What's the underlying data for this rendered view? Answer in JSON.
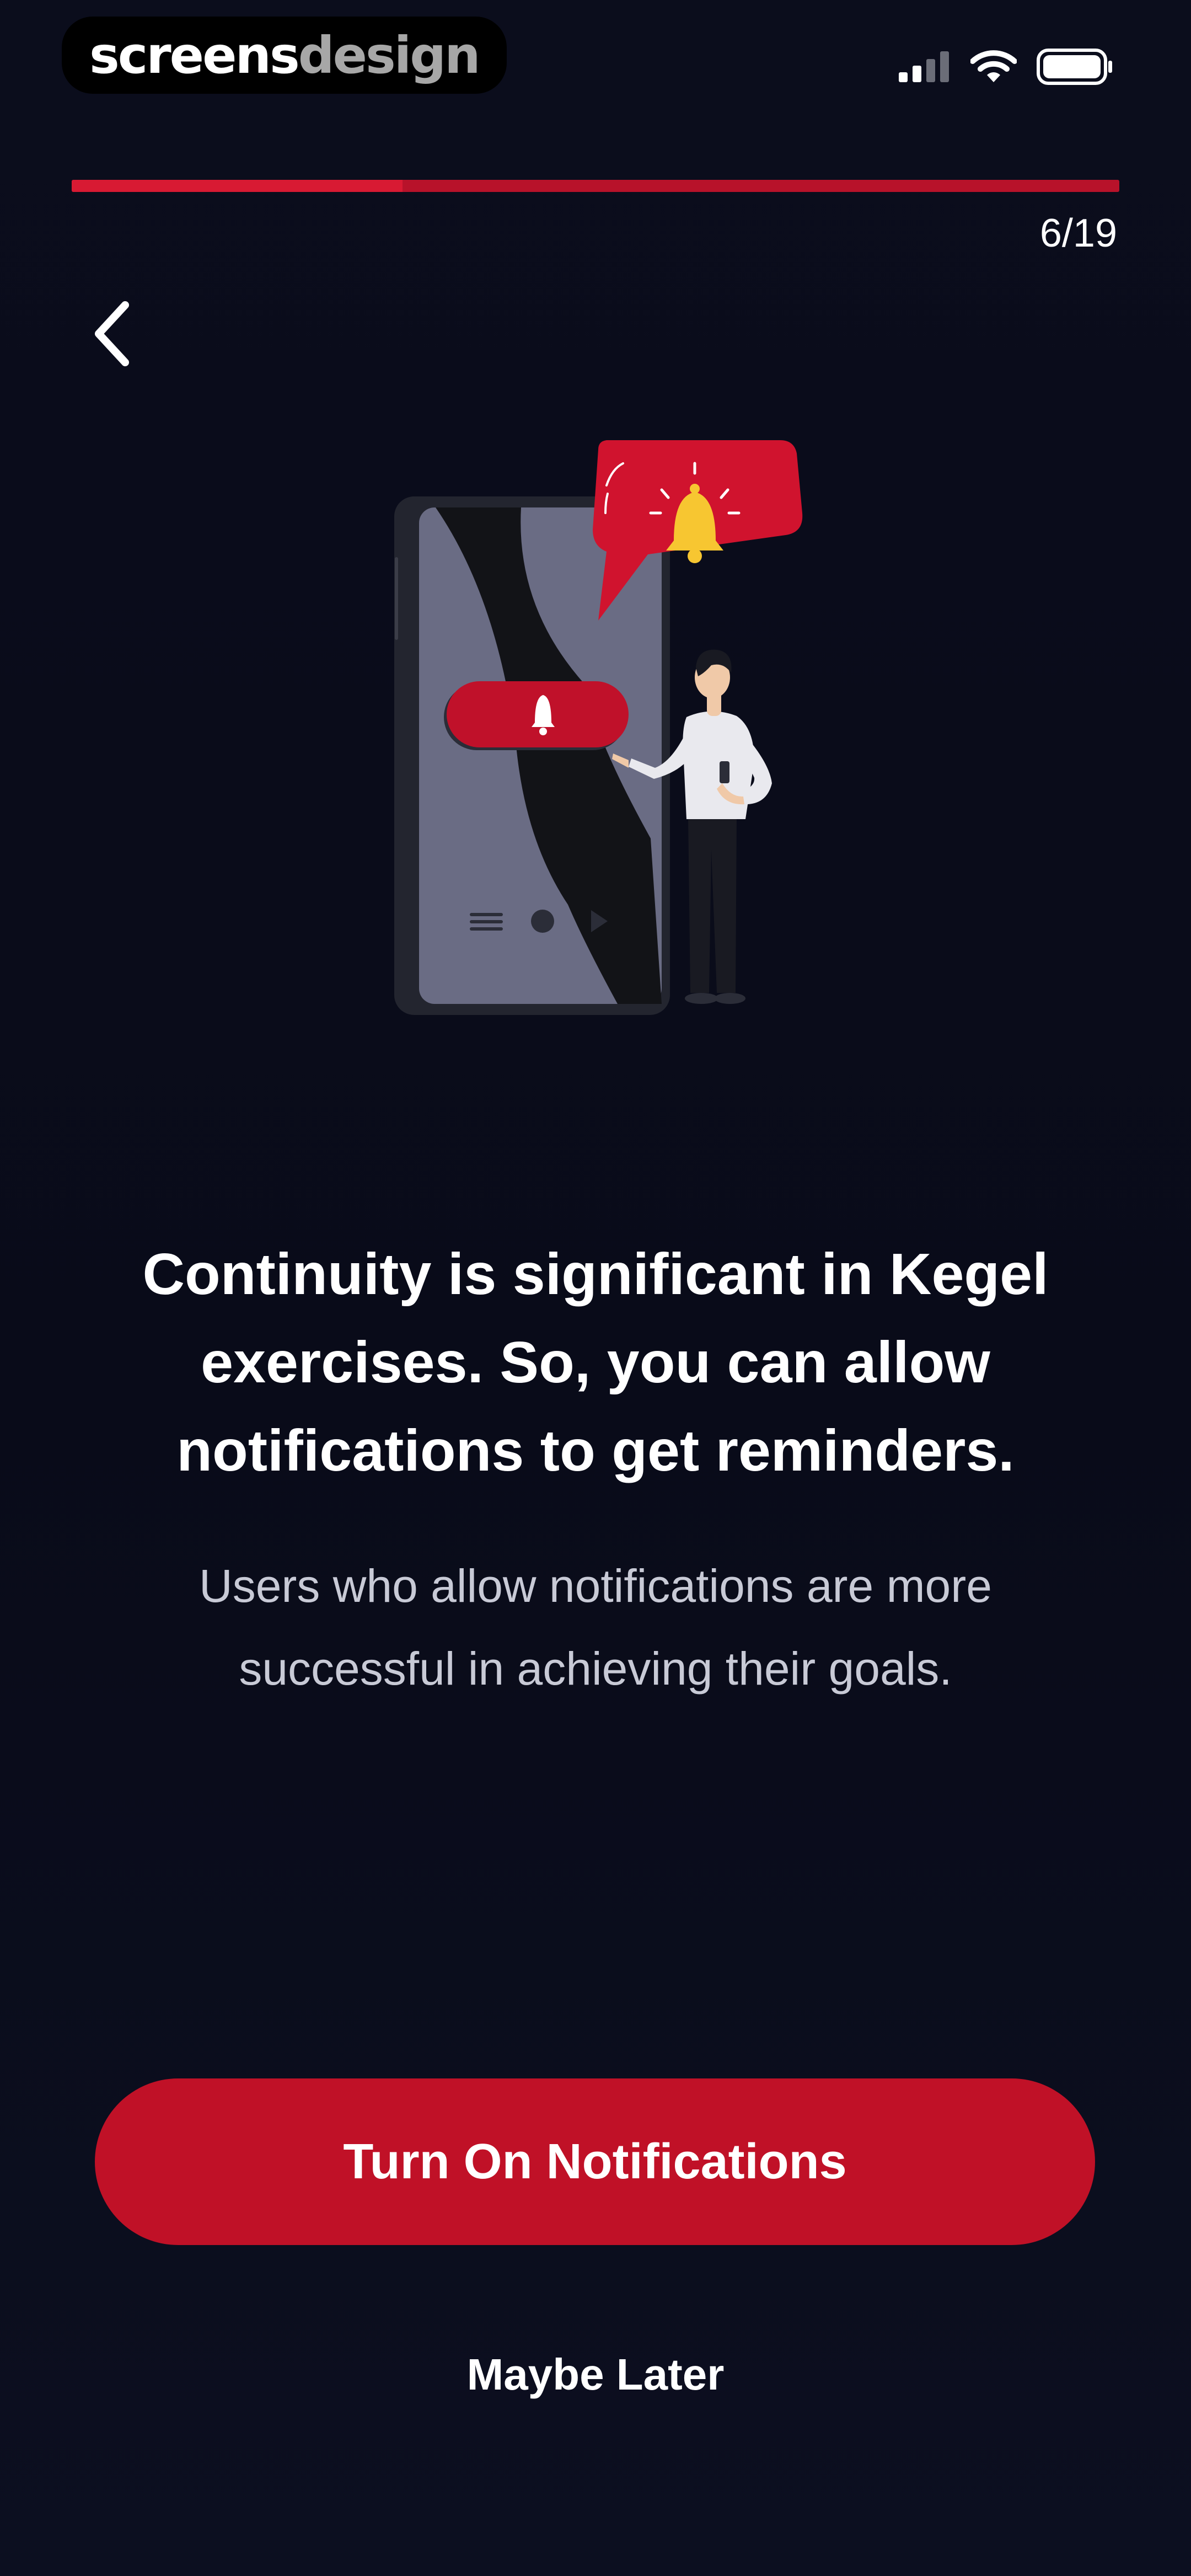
{
  "watermark": {
    "part1": "screens",
    "part2": "design"
  },
  "status_bar": {
    "icons": [
      "signal-icon",
      "wifi-icon",
      "battery-icon"
    ]
  },
  "progress": {
    "current": 6,
    "total": 19,
    "label": "6/19",
    "track_color": "#b8122a",
    "fill_color": "#d81a33"
  },
  "nav": {
    "back_icon": "chevron-left-icon"
  },
  "illustration": {
    "icons": [
      "phone-illustration",
      "bell-icon",
      "person-illustration",
      "speech-bubble"
    ]
  },
  "content": {
    "headline": "Continuity is significant in Kegel exercises. So, you can allow notifications to get reminders.",
    "subtext": "Users who allow notifications are more successful in achieving their goals."
  },
  "actions": {
    "primary_label": "Turn On Notifications",
    "secondary_label": "Maybe Later"
  },
  "colors": {
    "background": "#0b0d1c",
    "accent": "#c01127",
    "text_primary": "#ffffff",
    "text_secondary": "#c8cad6"
  }
}
